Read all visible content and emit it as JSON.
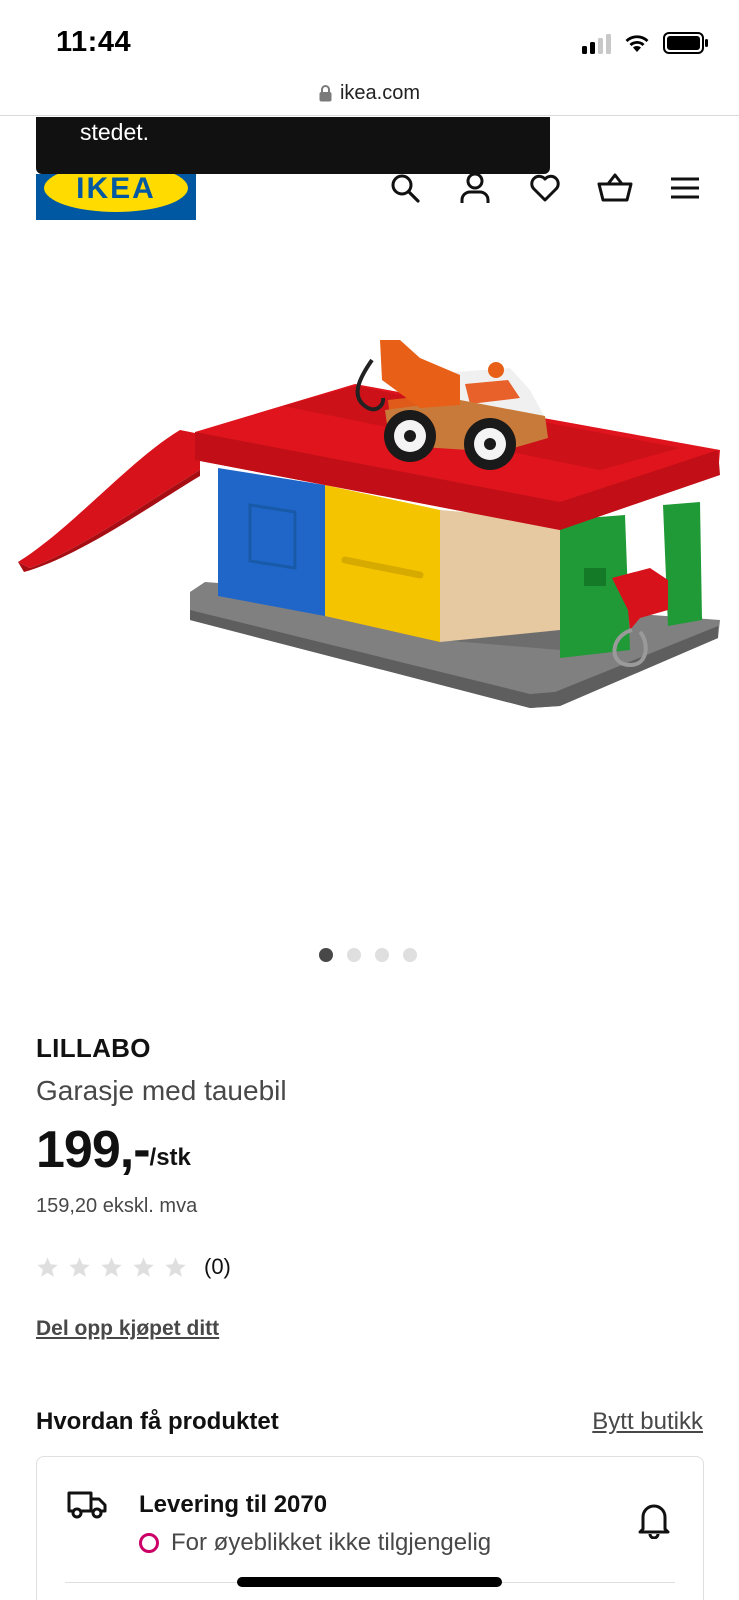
{
  "status_bar": {
    "time": "11:44"
  },
  "browser": {
    "url": "ikea.com"
  },
  "toast": {
    "text": "stedet."
  },
  "header": {
    "logo_text": "IKEA",
    "icons": [
      "search-icon",
      "profile-icon",
      "heart-icon",
      "basket-icon",
      "menu-icon"
    ]
  },
  "carousel": {
    "count": 4,
    "active_index": 0
  },
  "product": {
    "brand": "LILLABO",
    "description": "Garasje med tauebil",
    "price": "199,-",
    "price_unit": "/stk",
    "price_ex_vat": "159,20 ekskl. mva",
    "rating_stars": 0,
    "rating_count": "(0)",
    "split_payment_link": "Del opp kjøpet ditt"
  },
  "availability": {
    "heading": "Hvordan få produktet",
    "change_store_link": "Bytt butikk",
    "delivery": {
      "title": "Levering til 2070",
      "status": "For øyeblikket ikke tilgjengelig",
      "status_color": "#cc0066"
    }
  },
  "colors": {
    "ikea_blue": "#0058a3",
    "ikea_yellow": "#ffdb00",
    "text_secondary": "#484848"
  }
}
